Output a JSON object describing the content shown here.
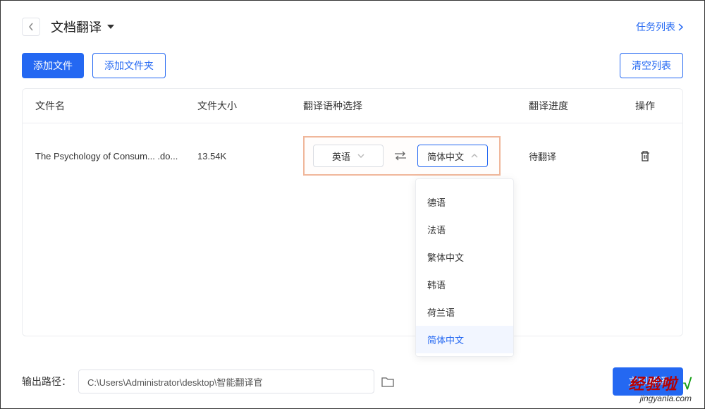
{
  "header": {
    "title": "文档翻译",
    "task_list": "任务列表"
  },
  "toolbar": {
    "add_file": "添加文件",
    "add_folder": "添加文件夹",
    "clear_list": "清空列表"
  },
  "columns": {
    "name": "文件名",
    "size": "文件大小",
    "lang": "翻译语种选择",
    "progress": "翻译进度",
    "op": "操作"
  },
  "row": {
    "name": "The Psychology of Consum... .do...",
    "size": "13.54K",
    "status": "待翻译"
  },
  "lang": {
    "source": "英语",
    "target": "简体中文",
    "dropdown": [
      "德语",
      "法语",
      "繁体中文",
      "韩语",
      "荷兰语",
      "简体中文"
    ],
    "selected": "简体中文"
  },
  "footer": {
    "out_label": "输出路径：",
    "out_path": "C:\\Users\\Administrator\\desktop\\智能翻译官",
    "translate": "立即翻译"
  },
  "watermark": {
    "big": "经验啦",
    "check": "√",
    "small": "jingyanla.com"
  }
}
